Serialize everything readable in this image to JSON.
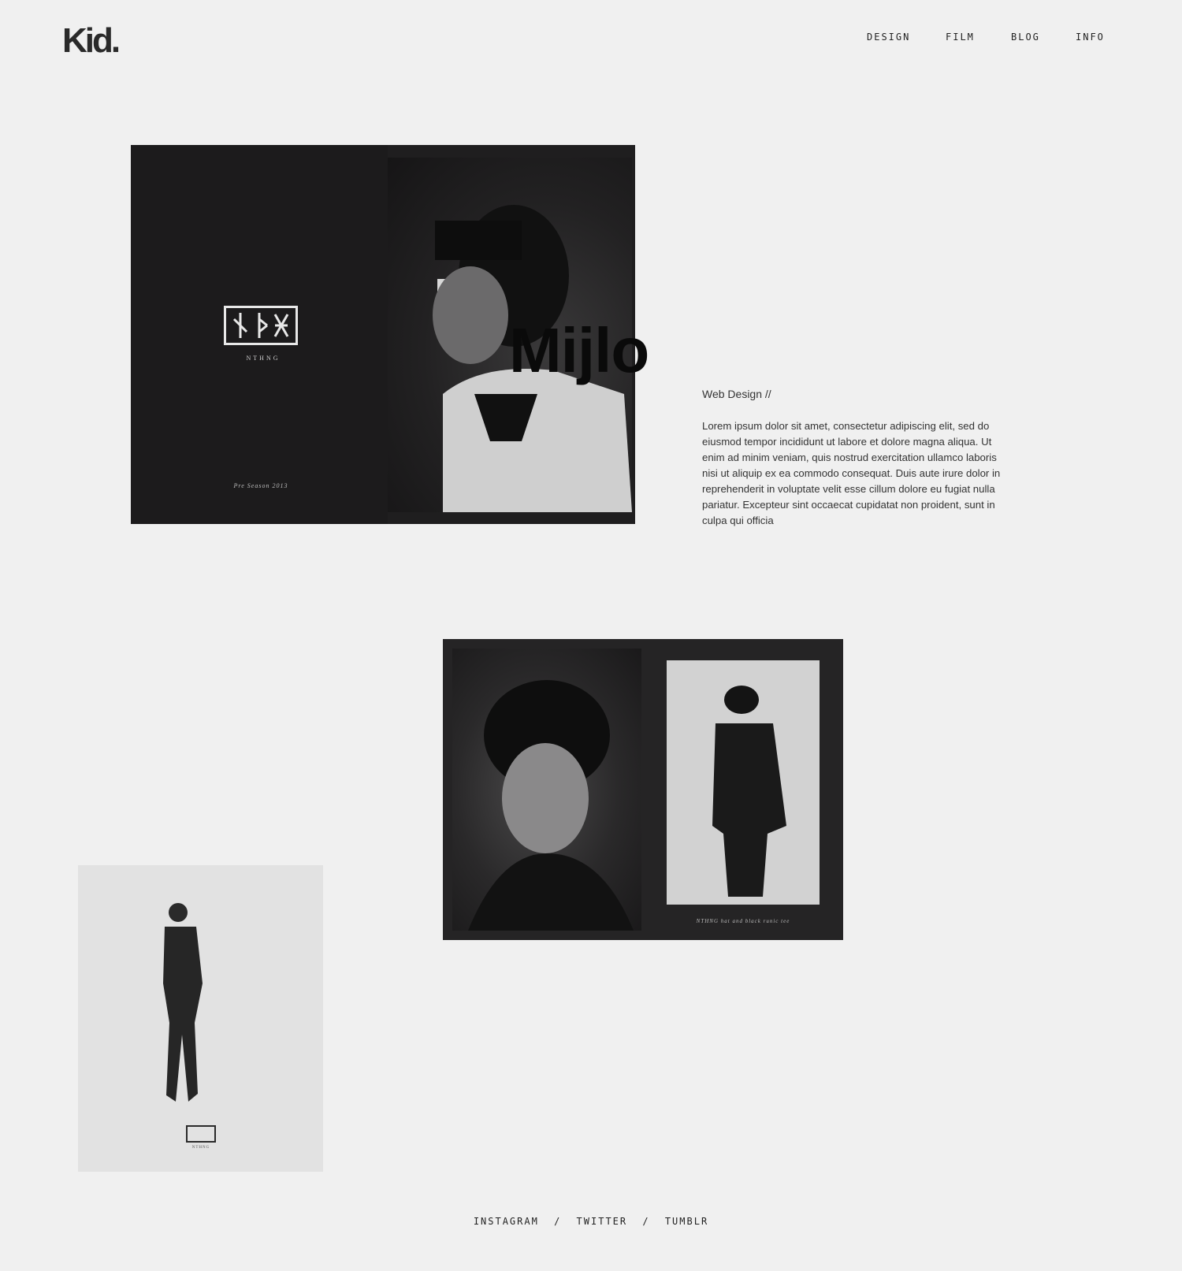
{
  "header": {
    "logo": "Kid.",
    "nav": [
      {
        "label": "DESIGN"
      },
      {
        "label": "FILM"
      },
      {
        "label": "BLOG"
      },
      {
        "label": "INFO"
      }
    ]
  },
  "project": {
    "title": "Mijlo",
    "category": "Web Design //",
    "description": "Lorem ipsum dolor sit amet, consectetur adipiscing elit, sed do eiusmod tempor incididunt ut labore et dolore magna aliqua. Ut enim ad minim veniam, quis nostrud exercitation ullamco laboris nisi ut aliquip ex ea commodo consequat. Duis aute irure dolor in reprehenderit in voluptate velit esse cillum dolore eu fugiat nulla pariatur. Excepteur sint occaecat cupidatat non proident, sunt in culpa qui officia",
    "hero": {
      "brand_caption": "NTHNG",
      "season_caption": "Pre Season 2013"
    },
    "spread": {
      "caption": "NTHNG hat and black runic tee"
    },
    "poster": {
      "brand_caption": "NTHNG"
    }
  },
  "footer": {
    "links": [
      {
        "label": "INSTAGRAM"
      },
      {
        "label": "TWITTER"
      },
      {
        "label": "TUMBLR"
      }
    ],
    "separator": "/"
  }
}
